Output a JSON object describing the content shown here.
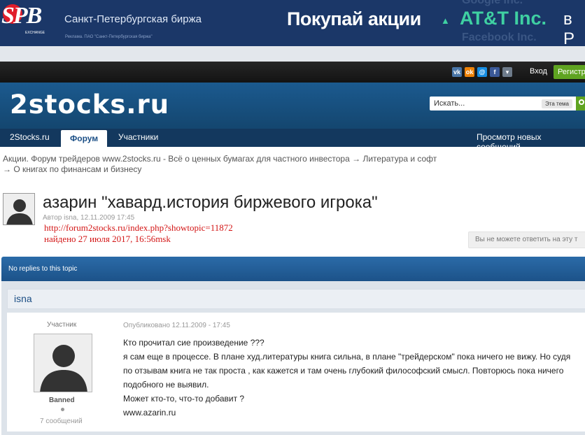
{
  "ad": {
    "logo_text": "SPB",
    "logo_subtext": "EXCHANGE",
    "exchange_name": "Санкт-Петербургская биржа",
    "legal": "Реклама. ПАО \"Санкт-Петербургская биржа\"",
    "slogan": "Покупай акции",
    "arrow": "▲",
    "stock_name": "AT&T Inc.",
    "suffix": "в Р",
    "ghost_top": "Google Inc.",
    "ghost_bottom": "Facebook Inc.",
    "colors": {
      "background": "#1b3768",
      "accent": "#3fd0a2",
      "logo_red": "#e11d2a"
    }
  },
  "topbar": {
    "social_icons": [
      "vk-icon",
      "odnoklassniki-icon",
      "mailru-icon",
      "facebook-icon",
      "more-dropdown-icon"
    ],
    "social_glyphs": [
      "vk",
      "ok",
      "@",
      "f",
      "▾"
    ],
    "login": "Вход",
    "register": "Регистр"
  },
  "header": {
    "logo": "2stocks.ru",
    "search_placeholder": "Искать...",
    "search_scope": "Эта тема",
    "colors": {
      "background": "#1b5a8f",
      "go_button": "#5fa421"
    }
  },
  "nav": {
    "tabs": [
      {
        "label": "2Stocks.ru",
        "active": false
      },
      {
        "label": "Форум",
        "active": true
      },
      {
        "label": "Участники",
        "active": false
      }
    ],
    "right_link": "Просмотр новых сообщений"
  },
  "breadcrumb": {
    "items": [
      "Акции. Форум трейдеров www.2stocks.ru - Всё о ценных бумагах для частного инвестора",
      "Литература и софт",
      "О книгах по финансам и бизнесу"
    ],
    "separator": "→"
  },
  "topic": {
    "title": "азарин \"хавард.история биржевого игрока\"",
    "meta": "Автор isna, 12.11.2009 17:45",
    "stamp_url": "http://forum2stocks.ru/index.php?showtopic=11872",
    "stamp_found": "найдено 27 июля 2017, 16:56msk",
    "cant_reply": "Вы не можете ответить на эту т"
  },
  "post": {
    "replies_label": "No replies to this topic",
    "author": "isna",
    "role": "Участник",
    "status": "Banned",
    "messages": "7 сообщений",
    "published": "Опубликовано 12.11.2009 - 17:45",
    "lines": [
      "Кто прочитал сие произведение ???",
      "я сам еще в процессе. В плане худ.литературы книга сильна, в плане \"трейдерском\" пока ничего не вижу. Но судя по отзывам книга не так проста , как кажется и там очень глубокий философский смысл. Повторюсь пока ничего подобного не выявил.",
      "Может кто-то, что-то добавит ?",
      "www.azarin.ru"
    ]
  }
}
